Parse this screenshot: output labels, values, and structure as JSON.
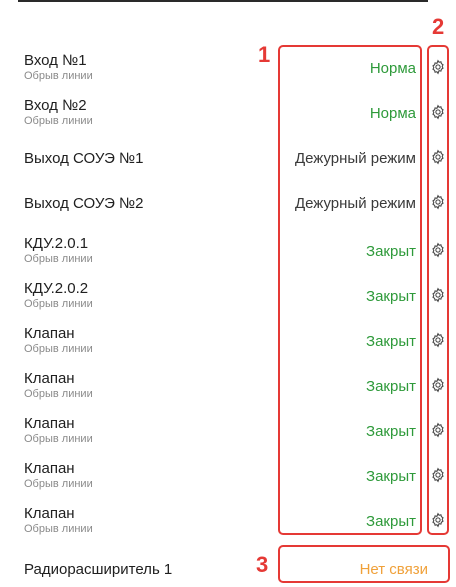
{
  "colors": {
    "ok": "#2e9a3a",
    "neutral": "#3a3a3a",
    "warn": "#f0a13a",
    "annotation": "#e53935"
  },
  "markers": {
    "statuses": "1",
    "settings": "2",
    "connection": "3"
  },
  "rows": [
    {
      "name": "Вход №1",
      "sub": "Обрыв линии",
      "status": "Норма",
      "tone": "ok"
    },
    {
      "name": "Вход №2",
      "sub": "Обрыв линии",
      "status": "Норма",
      "tone": "ok"
    },
    {
      "name": "Выход СОУЭ №1",
      "sub": "",
      "status": "Дежурный режим",
      "tone": "neutral"
    },
    {
      "name": "Выход СОУЭ №2",
      "sub": "",
      "status": "Дежурный режим",
      "tone": "neutral"
    },
    {
      "name": "КДУ.2.0.1",
      "sub": "Обрыв линии",
      "status": "Закрыт",
      "tone": "ok"
    },
    {
      "name": "КДУ.2.0.2",
      "sub": "Обрыв линии",
      "status": "Закрыт",
      "tone": "ok"
    },
    {
      "name": "Клапан",
      "sub": "Обрыв линии",
      "status": "Закрыт",
      "tone": "ok"
    },
    {
      "name": "Клапан",
      "sub": "Обрыв линии",
      "status": "Закрыт",
      "tone": "ok"
    },
    {
      "name": "Клапан",
      "sub": "Обрыв линии",
      "status": "Закрыт",
      "tone": "ok"
    },
    {
      "name": "Клапан",
      "sub": "Обрыв линии",
      "status": "Закрыт",
      "tone": "ok"
    },
    {
      "name": "Клапан",
      "sub": "Обрыв линии",
      "status": "Закрыт",
      "tone": "ok"
    }
  ],
  "footer": {
    "name": "Радиорасширитель 1",
    "status": "Нет связи",
    "tone": "warn"
  }
}
